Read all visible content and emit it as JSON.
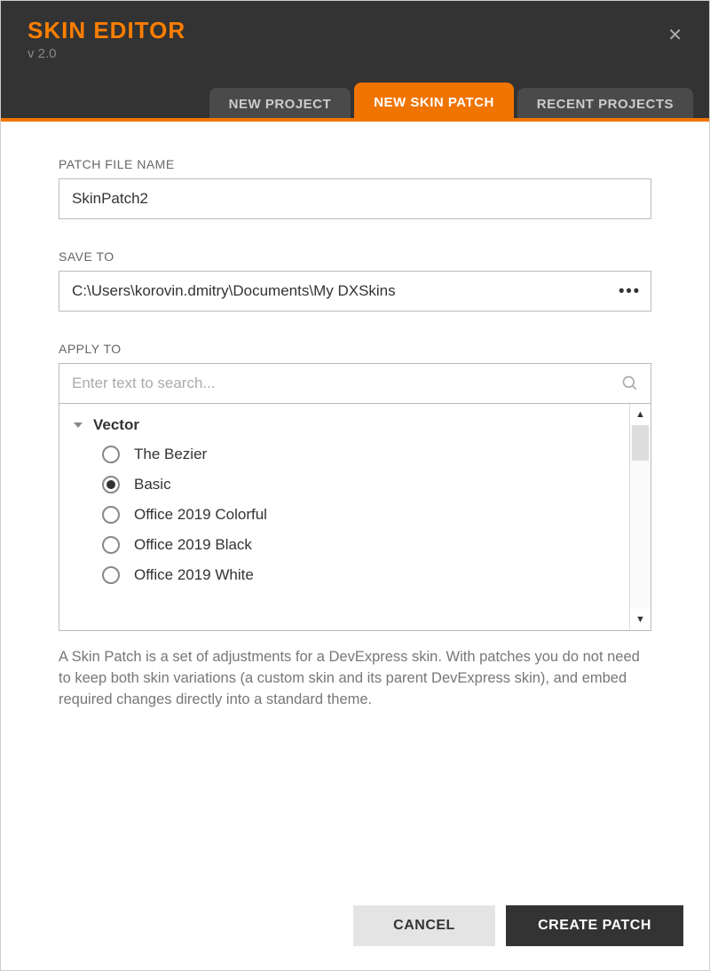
{
  "header": {
    "title": "SKIN EDITOR",
    "version": "v 2.0"
  },
  "tabs": [
    {
      "label": "NEW PROJECT",
      "active": false
    },
    {
      "label": "NEW SKIN PATCH",
      "active": true
    },
    {
      "label": "RECENT PROJECTS",
      "active": false
    }
  ],
  "form": {
    "patchFileName": {
      "label": "PATCH FILE NAME",
      "value": "SkinPatch2"
    },
    "saveTo": {
      "label": "SAVE TO",
      "value": "C:\\Users\\korovin.dmitry\\Documents\\My DXSkins"
    },
    "applyTo": {
      "label": "APPLY TO",
      "searchPlaceholder": "Enter text to search...",
      "group": "Vector",
      "items": [
        {
          "label": "The Bezier",
          "selected": false
        },
        {
          "label": "Basic",
          "selected": true
        },
        {
          "label": "Office 2019 Colorful",
          "selected": false
        },
        {
          "label": "Office 2019 Black",
          "selected": false
        },
        {
          "label": "Office 2019 White",
          "selected": false
        }
      ]
    },
    "description": "A Skin Patch is a set of adjustments for a DevExpress skin. With patches you do not need to keep both skin variations (a custom skin and its parent DevExpress skin), and embed required changes directly into a standard theme."
  },
  "buttons": {
    "cancel": "CANCEL",
    "create": "CREATE PATCH"
  }
}
